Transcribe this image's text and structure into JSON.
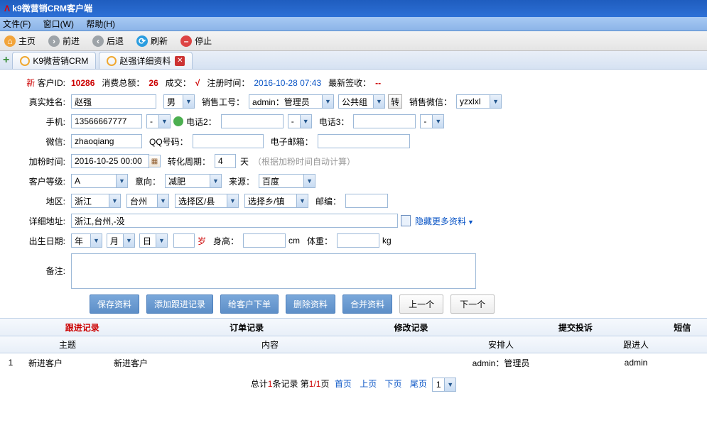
{
  "window": {
    "title": "k9微营销CRM客户端"
  },
  "menu": {
    "file": "文件(F)",
    "window": "窗口(W)",
    "help": "帮助(H)"
  },
  "toolbar": {
    "home": "主页",
    "forward": "前进",
    "back": "后退",
    "refresh": "刷新",
    "stop": "停止"
  },
  "tabs": {
    "t1": "K9微营销CRM",
    "t2": "赵强详细资料"
  },
  "header": {
    "newLabel": "新",
    "custIdLabel": "客户ID:",
    "custId": "10286",
    "spendLabel": "消费总额：",
    "spend": "26",
    "dealLabel": "成交：",
    "dealMark": "√",
    "regLabel": "注册时间：",
    "regTime": "2016-10-28 07:43",
    "signLabel": "最新签收：",
    "signVal": "--"
  },
  "form": {
    "nameLabel": "真实姓名:",
    "name": "赵强",
    "gender": "男",
    "agentLabel": "销售工号：",
    "agent": "admin：管理员",
    "group": "公共组",
    "transfer": "转",
    "wechatSalesLabel": "销售微信：",
    "wechatSales": "yzxlxl",
    "phoneLabel": "手机:",
    "phone": "13566667777",
    "phoneArea": "-",
    "phone2Label": "电话2：",
    "phone2": "",
    "phone2Area": "-",
    "phone3Label": "电话3：",
    "phone3": "",
    "phone3Area": "-",
    "wxLabel": "微信:",
    "wx": "zhaoqiang",
    "qqLabel": "QQ号码：",
    "qq": "",
    "emailLabel": "电子邮箱：",
    "email": "",
    "addFansLabel": "加粉时间:",
    "addFans": "2016-10-25 00:00",
    "convLabel": "转化周期：",
    "conv": "4",
    "dayLabel": "天",
    "convHint": "（根据加粉时间自动计算）",
    "levelLabel": "客户等级:",
    "level": "A",
    "intentLabel": "意向：",
    "intent": "减肥",
    "sourceLabel": "来源：",
    "source": "百度",
    "regionLabel": "地区:",
    "province": "浙江",
    "city": "台州",
    "district": "选择区/县",
    "town": "选择乡/镇",
    "zipLabel": "邮编：",
    "zip": "",
    "addrLabel": "详细地址:",
    "addr": "浙江,台州,-没",
    "hideMore": "隐藏更多资料",
    "birthLabel": "出生日期:",
    "year": "年",
    "month": "月",
    "day": "日",
    "ageLabel": "岁",
    "heightLabel": "身高：",
    "heightUnit": "cm",
    "weightLabel": "体重：",
    "weightUnit": "kg",
    "notesLabel": "备注:"
  },
  "buttons": {
    "save": "保存资料",
    "addFollow": "添加跟进记录",
    "order": "给客户下单",
    "delete": "删除资料",
    "merge": "合并资料",
    "prev": "上一个",
    "next": "下一个"
  },
  "recordTabs": {
    "follow": "跟进记录",
    "order": "订单记录",
    "modify": "修改记录",
    "complaint": "提交投诉",
    "sms": "短信"
  },
  "table": {
    "headers": {
      "topic": "主题",
      "content": "内容",
      "arranger": "安排人",
      "follower": "跟进人"
    },
    "rows": [
      {
        "idx": "1",
        "topic": "新进客户",
        "content": "新进客户",
        "arranger": "admin：管理员",
        "follower": "admin"
      }
    ]
  },
  "pager": {
    "total1": "总计",
    "count": "1",
    "total2": "条记录 第",
    "page": "1/1",
    "total3": "页",
    "first": "首页",
    "prev": "上页",
    "next": "下页",
    "last": "尾页",
    "sel": "1"
  }
}
